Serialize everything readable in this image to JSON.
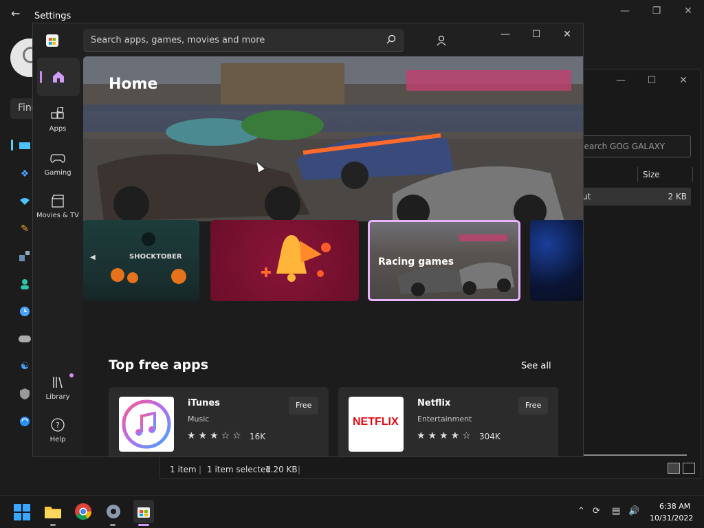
{
  "settings": {
    "title": "Settings",
    "back_icon": "back-arrow-icon",
    "find_text": "Find",
    "sidebar_icons": [
      "system-icon",
      "bluetooth-icon",
      "network-icon",
      "personalization-icon",
      "apps-icon",
      "accounts-icon",
      "time-language-icon",
      "gaming-icon",
      "accessibility-icon",
      "privacy-security-icon",
      "windows-update-icon"
    ]
  },
  "explorer": {
    "search_placeholder": "Search GOG GALAXY",
    "column_size": "Size",
    "row": {
      "name": "ut",
      "size": "2 KB"
    },
    "status": {
      "count": "1 item",
      "selected": "1 item selected",
      "size": "1.20 KB"
    }
  },
  "store": {
    "search_placeholder": "Search apps, games, movies and more",
    "nav": {
      "home": "",
      "apps": "Apps",
      "gaming": "Gaming",
      "movies": "Movies & TV",
      "library": "Library",
      "help": "Help"
    },
    "hero": {
      "title": "Home"
    },
    "carousel": [
      {
        "label": ""
      },
      {
        "label": ""
      },
      {
        "label": "Racing games"
      },
      {
        "label": ""
      }
    ],
    "shocktober_text": "SHOCKTOBER",
    "section": {
      "title": "Top free apps",
      "see_all": "See all"
    },
    "apps": [
      {
        "name": "iTunes",
        "category": "Music",
        "rating": "16K",
        "stars": 3,
        "price": "Free"
      },
      {
        "name": "Netflix",
        "category": "Entertainment",
        "rating": "304K",
        "stars": 4,
        "price": "Free",
        "logo_text": "NETFLIX"
      }
    ]
  },
  "taskbar": {
    "apps": [
      "start-icon",
      "file-explorer-icon",
      "chrome-icon",
      "settings-icon",
      "store-icon"
    ],
    "clock": {
      "time": "6:38 AM",
      "date": "10/31/2022"
    }
  },
  "colors": {
    "accent": "#c88cf0",
    "selected_tile_border": "#e8b3ff",
    "netflix_red": "#e50914"
  }
}
